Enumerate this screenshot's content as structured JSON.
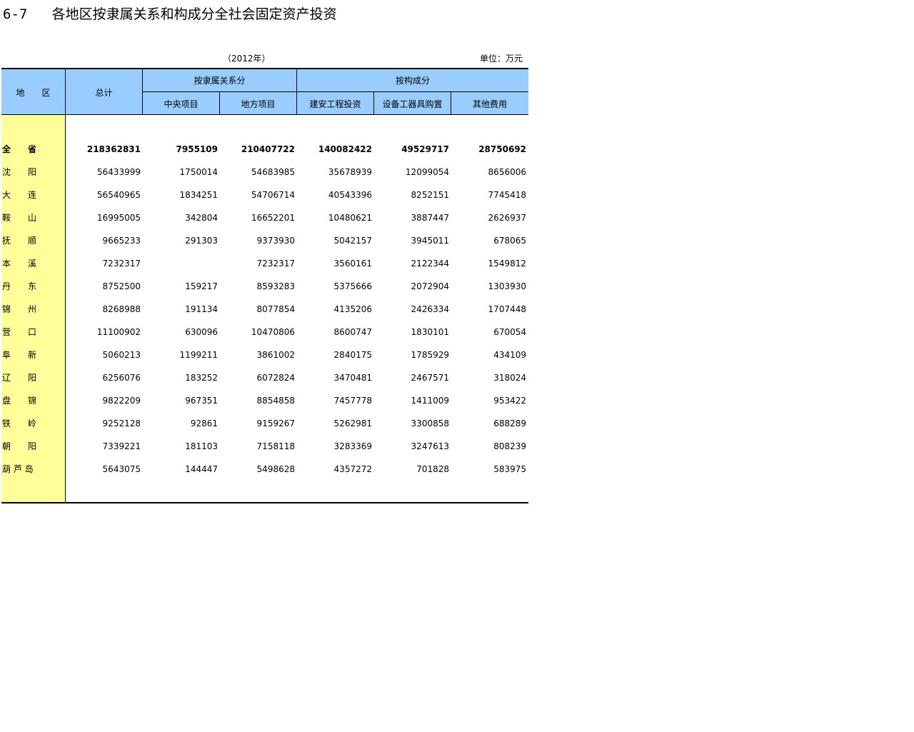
{
  "title": "6-7   各地区按隶属关系和构成分全社会固定资产投资",
  "year": "（2012年）",
  "unit": "单位：万元",
  "headers": {
    "region": "地　　区",
    "total": "总计",
    "affiliation_group": "按隶属关系分",
    "central": "中央项目",
    "local": "地方项目",
    "composition_group": "按构成分",
    "construction": "建安工程投资",
    "equipment": "设备工器具购置",
    "other": "其他费用"
  },
  "rows": [
    {
      "region": "全　　省",
      "total": "218362831",
      "central": "7955109",
      "local": "210407722",
      "construction": "140082422",
      "equipment": "49529717",
      "other": "28750692"
    },
    {
      "region": "沈　　阳",
      "total": "56433999",
      "central": "1750014",
      "local": "54683985",
      "construction": "35678939",
      "equipment": "12099054",
      "other": "8656006"
    },
    {
      "region": "大　　连",
      "total": "56540965",
      "central": "1834251",
      "local": "54706714",
      "construction": "40543396",
      "equipment": "8252151",
      "other": "7745418"
    },
    {
      "region": "鞍　　山",
      "total": "16995005",
      "central": "342804",
      "local": "16652201",
      "construction": "10480621",
      "equipment": "3887447",
      "other": "2626937"
    },
    {
      "region": "抚　　顺",
      "total": "9665233",
      "central": "291303",
      "local": "9373930",
      "construction": "5042157",
      "equipment": "3945011",
      "other": "678065"
    },
    {
      "region": "本　　溪",
      "total": "7232317",
      "central": "",
      "local": "7232317",
      "construction": "3560161",
      "equipment": "2122344",
      "other": "1549812"
    },
    {
      "region": "丹　　东",
      "total": "8752500",
      "central": "159217",
      "local": "8593283",
      "construction": "5375666",
      "equipment": "2072904",
      "other": "1303930"
    },
    {
      "region": "锦　　州",
      "total": "8268988",
      "central": "191134",
      "local": "8077854",
      "construction": "4135206",
      "equipment": "2426334",
      "other": "1707448"
    },
    {
      "region": "营　　口",
      "total": "11100902",
      "central": "630096",
      "local": "10470806",
      "construction": "8600747",
      "equipment": "1830101",
      "other": "670054"
    },
    {
      "region": "阜　　新",
      "total": "5060213",
      "central": "1199211",
      "local": "3861002",
      "construction": "2840175",
      "equipment": "1785929",
      "other": "434109"
    },
    {
      "region": "辽　　阳",
      "total": "6256076",
      "central": "183252",
      "local": "6072824",
      "construction": "3470481",
      "equipment": "2467571",
      "other": "318024"
    },
    {
      "region": "盘　　锦",
      "total": "9822209",
      "central": "967351",
      "local": "8854858",
      "construction": "7457778",
      "equipment": "1411009",
      "other": "953422"
    },
    {
      "region": "铁　　岭",
      "total": "9252128",
      "central": "92861",
      "local": "9159267",
      "construction": "5262981",
      "equipment": "3300858",
      "other": "688289"
    },
    {
      "region": "朝　　阳",
      "total": "7339221",
      "central": "181103",
      "local": "7158118",
      "construction": "3283369",
      "equipment": "3247613",
      "other": "808239"
    },
    {
      "region": "葫 芦 岛",
      "total": "5643075",
      "central": "144447",
      "local": "5498628",
      "construction": "4357272",
      "equipment": "701828",
      "other": "583975"
    }
  ]
}
